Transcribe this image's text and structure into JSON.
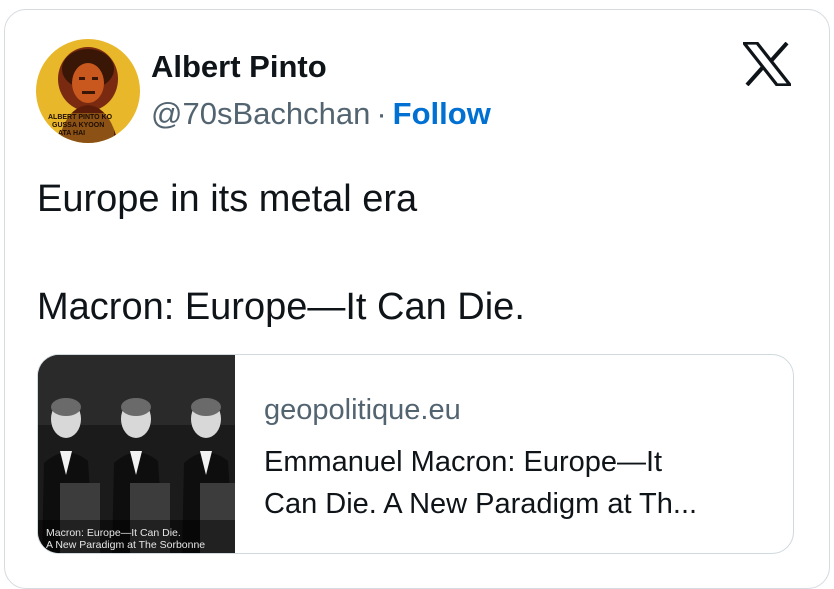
{
  "author": {
    "display_name": "Albert Pinto",
    "handle": "@70sBachchan",
    "separator": "·",
    "follow_label": "Follow",
    "avatar_caption": [
      "ALBERT PINTO KO",
      "GUSSA KYOON",
      "ATA HAI"
    ]
  },
  "brand_icon": "x-logo-icon",
  "tweet": {
    "lines": [
      "Europe in its metal era",
      "Macron: Europe—It Can Die."
    ]
  },
  "link_card": {
    "domain": "geopolitique.eu",
    "title_lines": [
      "Emmanuel Macron: Europe—It",
      "Can Die. A New Paradigm at Th..."
    ],
    "thumbnail_caption": [
      "Macron: Europe—It Can Die.",
      "A New Paradigm at The Sorbonne"
    ]
  },
  "colors": {
    "text_primary": "#0f1419",
    "text_secondary": "#536471",
    "follow_blue": "#0070d2",
    "border": "#d6dbe0"
  }
}
